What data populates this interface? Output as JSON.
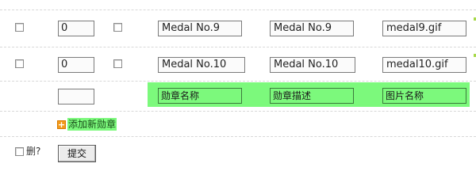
{
  "rows": [
    {
      "order": "0",
      "name": "Medal No.9",
      "description": "Medal No.9",
      "image": "medal9.gif"
    },
    {
      "order": "0",
      "name": "Medal No.10",
      "description": "Medal No.10",
      "image": "medal10.gif"
    }
  ],
  "new_row": {
    "order": "",
    "name_placeholder": "勋章名称",
    "description_placeholder": "勋章描述",
    "image_placeholder": "图片名称"
  },
  "add_link": {
    "label": "添加新勋章",
    "icon": "plus-icon"
  },
  "footer": {
    "delete_label": "删?",
    "submit_label": "提交"
  },
  "colors": {
    "highlight": "#7cf97c",
    "add_icon": "#f39b1b"
  }
}
